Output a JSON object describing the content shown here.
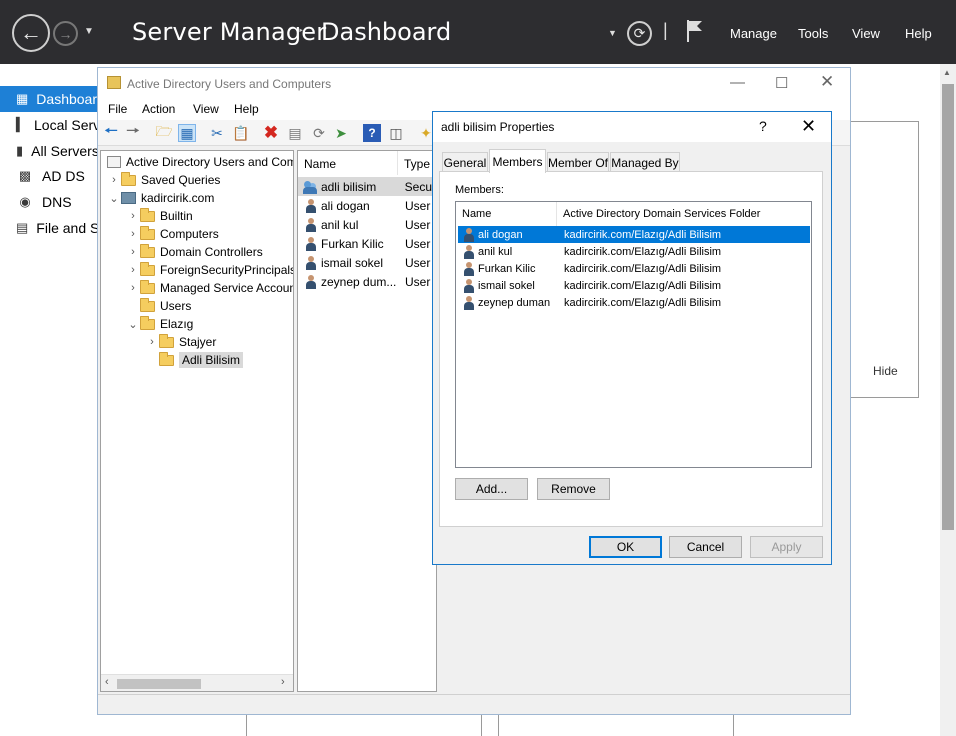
{
  "server_manager": {
    "title": "Server Manager",
    "breadcrumb_sep": "‣",
    "page": "Dashboard",
    "menus": [
      "Manage",
      "Tools",
      "View",
      "Help"
    ],
    "nav": [
      {
        "label": "Dashboard",
        "icon": "dashboard-icon",
        "selected": true
      },
      {
        "label": "Local Server",
        "icon": "server-icon"
      },
      {
        "label": "All Servers",
        "icon": "servers-icon"
      },
      {
        "label": "AD DS",
        "icon": "ad-ds-icon"
      },
      {
        "label": "DNS",
        "icon": "dns-icon"
      },
      {
        "label": "File and Storage Services",
        "icon": "storage-icon"
      }
    ],
    "hide_label": "Hide"
  },
  "aduc": {
    "title": "Active Directory Users and Computers",
    "menus": [
      "File",
      "Action",
      "View",
      "Help"
    ],
    "tree": {
      "root": "Active Directory Users and Computers",
      "saved_queries": "Saved Queries",
      "domain": "kadircirik.com",
      "children": [
        "Builtin",
        "Computers",
        "Domain Controllers",
        "ForeignSecurityPrincipals",
        "Managed Service Accounts",
        "Users"
      ],
      "ou": "Elazıg",
      "ou_children": [
        "Stajyer",
        "Adli Bilisim"
      ],
      "selected": "Adli Bilisim"
    },
    "list": {
      "columns": [
        "Name",
        "Type"
      ],
      "rows": [
        {
          "name": "adli bilisim",
          "type": "Secur",
          "kind": "group"
        },
        {
          "name": "ali dogan",
          "type": "User",
          "kind": "user"
        },
        {
          "name": "anil kul",
          "type": "User",
          "kind": "user"
        },
        {
          "name": "Furkan Kilic",
          "type": "User",
          "kind": "user"
        },
        {
          "name": "ismail sokel",
          "type": "User",
          "kind": "user"
        },
        {
          "name": "zeynep dum...",
          "type": "User",
          "kind": "user"
        }
      ]
    }
  },
  "dialog": {
    "title": "adli bilisim Properties",
    "help": "?",
    "tabs": [
      "General",
      "Members",
      "Member Of",
      "Managed By"
    ],
    "active_tab": "Members",
    "members_label": "Members:",
    "columns": [
      "Name",
      "Active Directory Domain Services Folder"
    ],
    "members": [
      {
        "name": "ali dogan",
        "folder": "kadircirik.com/Elazıg/Adli Bilisim",
        "selected": true
      },
      {
        "name": "anil kul",
        "folder": "kadircirik.com/Elazıg/Adli Bilisim"
      },
      {
        "name": "Furkan Kilic",
        "folder": "kadircirik.com/Elazıg/Adli Bilisim"
      },
      {
        "name": "ismail sokel",
        "folder": "kadircirik.com/Elazıg/Adli Bilisim"
      },
      {
        "name": "zeynep duman",
        "folder": "kadircirik.com/Elazıg/Adli Bilisim"
      }
    ],
    "add_label": "Add...",
    "remove_label": "Remove",
    "ok_label": "OK",
    "cancel_label": "Cancel",
    "apply_label": "Apply"
  }
}
